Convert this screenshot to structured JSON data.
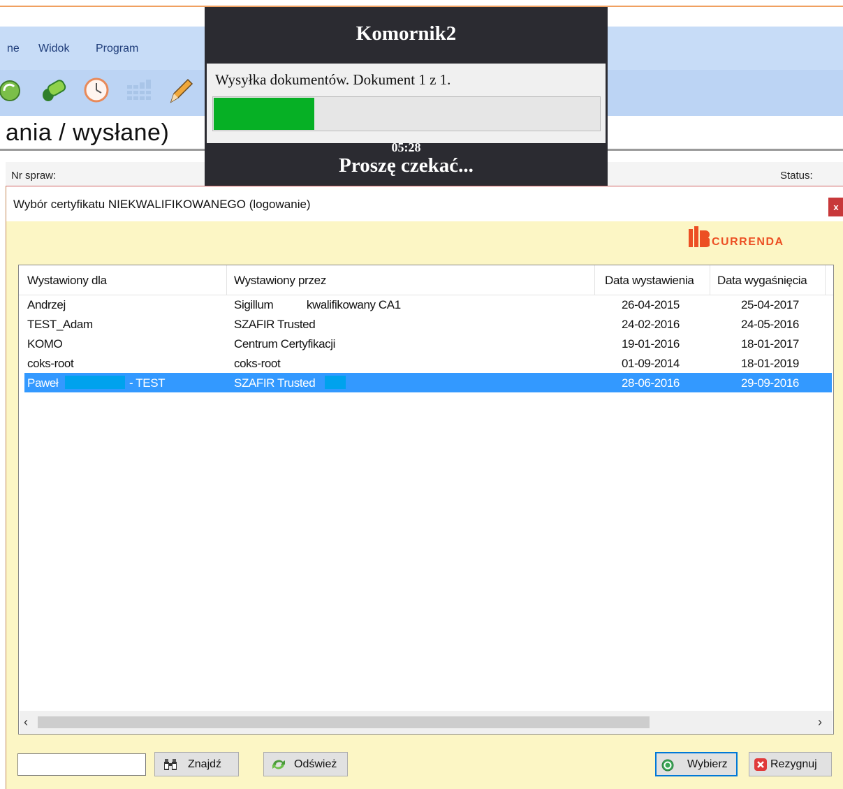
{
  "app": {
    "menu": [
      "ne",
      "Widok",
      "Program"
    ],
    "toolbar_icons": [
      "refresh-icon",
      "pipe-icon",
      "clock-icon",
      "calculator-icon",
      "pencil-icon"
    ],
    "section_title": "ania / wysłane)",
    "column_left": "Nr spraw:",
    "column_right": "Status:"
  },
  "popup": {
    "title": "Komornik2",
    "message": "Wysyłka dokumentów. Dokument 1 z 1.",
    "progress_fraction": 0.26,
    "progress_color": "#06b025",
    "time": "05:28",
    "wait": "Proszę czekać..."
  },
  "dialog": {
    "title": "Wybór certyfikatu NIEKWALIFIKOWANEGO (logowanie)",
    "close_label": "x",
    "logo_text": "CURRENDA",
    "brand_color": "#ec4f23",
    "columns": [
      "Wystawiony dla",
      "Wystawiony przez",
      "Data wystawienia",
      "Data wygaśnięcia"
    ],
    "rows": [
      {
        "for": "Andrzej",
        "by": "Sigillum           kwalifikowany CA1",
        "issued": "26-04-2015",
        "expires": "25-04-2017",
        "selected": false
      },
      {
        "for": "TEST_Adam",
        "by": "SZAFIR Trusted",
        "issued": "24-02-2016",
        "expires": "24-05-2016",
        "selected": false
      },
      {
        "for": "KOMO",
        "by": "Centrum Certyfikacji",
        "issued": "19-01-2016",
        "expires": "18-01-2017",
        "selected": false
      },
      {
        "for": "coks-root",
        "by": "coks-root",
        "issued": "01-09-2014",
        "expires": "18-01-2019",
        "selected": false
      },
      {
        "for": "Paweł",
        "for_suffix": "- TEST",
        "by": "SZAFIR Trusted",
        "issued": "28-06-2016",
        "expires": "29-09-2016",
        "selected": true
      }
    ],
    "search_value": "",
    "buttons": {
      "find": "Znajdź",
      "refresh": "Odśwież",
      "choose": "Wybierz",
      "cancel": "Rezygnuj"
    },
    "selection_color": "#3399ff"
  }
}
